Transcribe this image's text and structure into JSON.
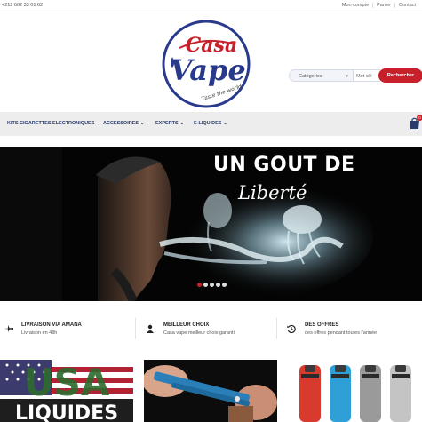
{
  "topbar": {
    "phone": "+212 662 33 01 62",
    "links": [
      "Mon compte",
      "Panier",
      "Contact"
    ]
  },
  "brand": {
    "line1": "Casa",
    "line2": "Vape",
    "tagline": "Taste the world"
  },
  "search": {
    "category_label": "Catégories",
    "keyword_placeholder": "Mot clé",
    "button_label": "Rechercher"
  },
  "nav": {
    "items": [
      "KITS CIGARETTES ELECTRONIQUES",
      "ACCESSOIRES",
      "EXPERTS",
      "E-LIQUIDES"
    ],
    "cart_count": "0"
  },
  "slider": {
    "headline": "UN GOUT DE",
    "script": "Liberté",
    "slide_count": 5,
    "active_slide": 1
  },
  "features": [
    {
      "title": "LIVRAISON VIA AMANA",
      "subtitle": "Livraison en 48h",
      "icon": "plane-icon"
    },
    {
      "title": "MEILLEUR CHOIX",
      "subtitle": "Casa vape meilleur choix garanti",
      "icon": "user-icon"
    },
    {
      "title": "DES OFFRES",
      "subtitle": "des offres pendant toutes l'année",
      "icon": "history-icon"
    }
  ],
  "tiles": {
    "usa_text": "USA",
    "liquides_text": "LIQUIDES"
  },
  "colors": {
    "accent": "#c8202b",
    "navy": "#2a3a6a",
    "nav_bg": "#ededed"
  }
}
